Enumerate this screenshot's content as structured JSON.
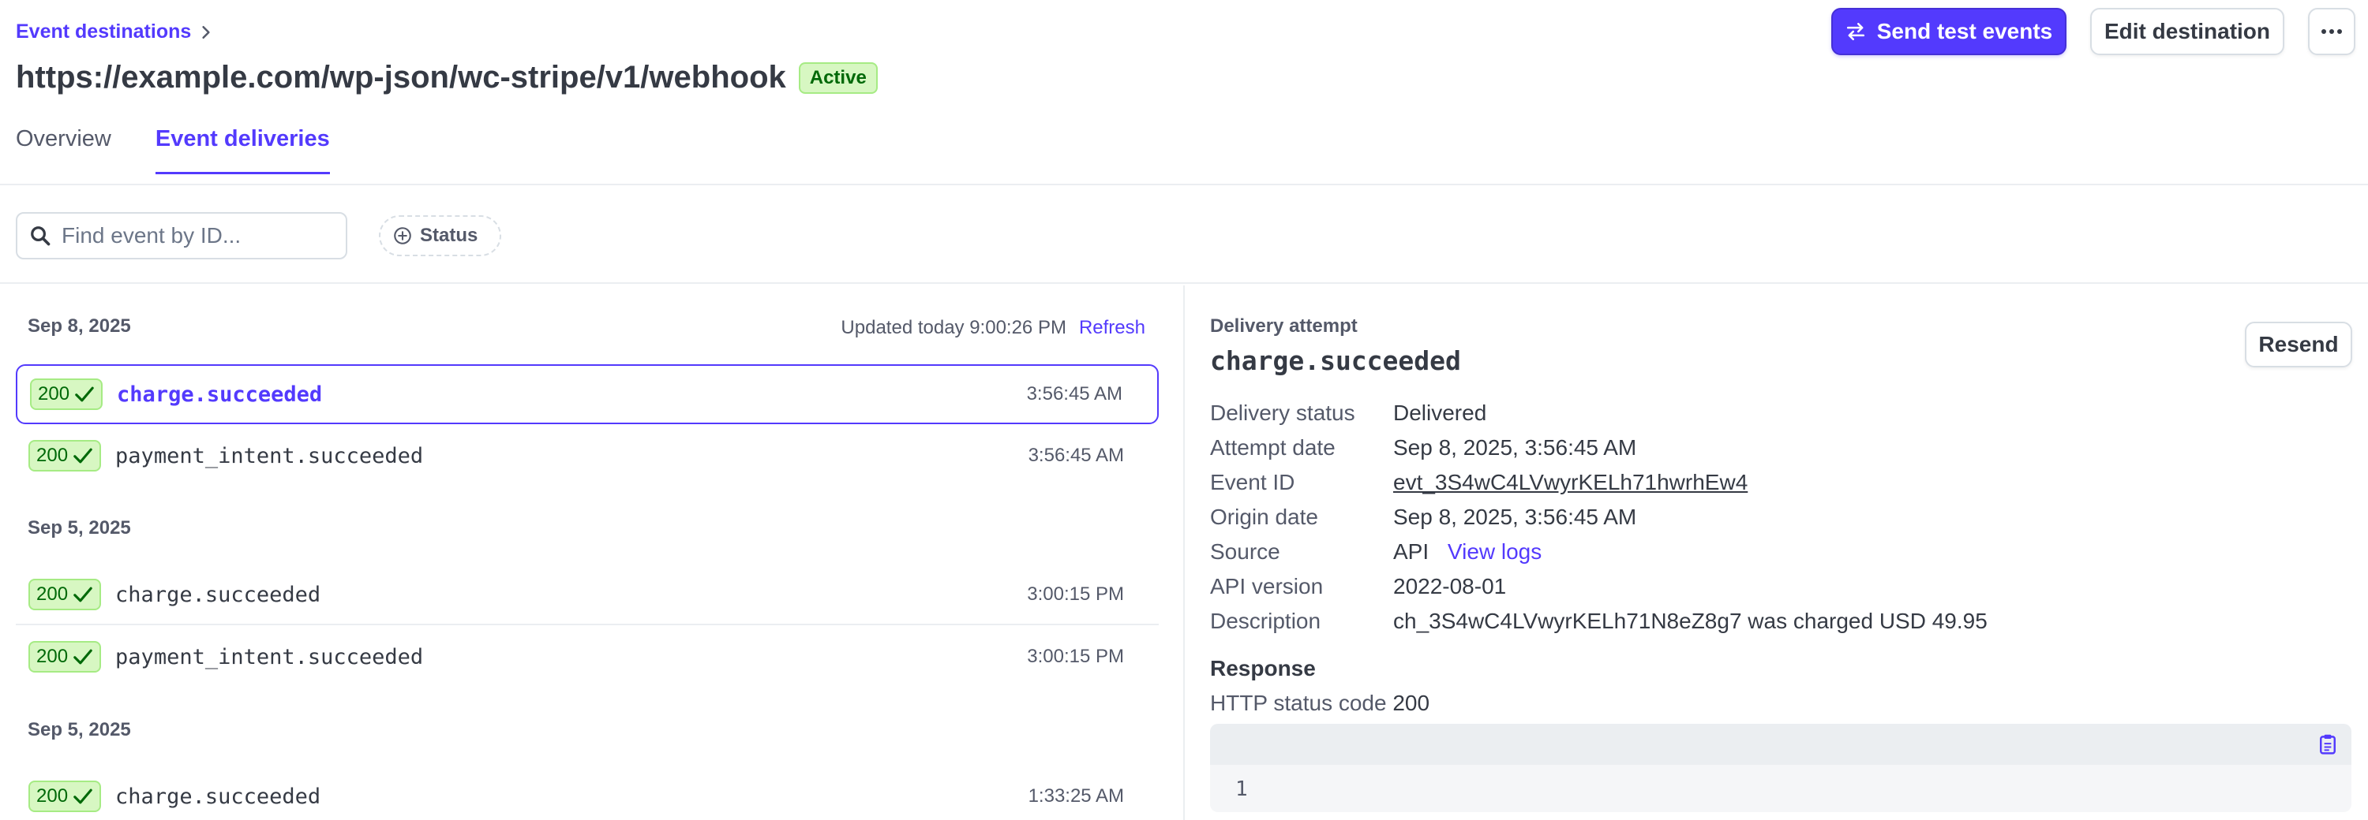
{
  "breadcrumb": {
    "label": "Event destinations"
  },
  "header": {
    "title": "https://example.com/wp-json/wc-stripe/v1/webhook",
    "status_badge": "Active",
    "send_test_label": "Send test events",
    "edit_label": "Edit destination",
    "more_label": "···"
  },
  "tabs": [
    {
      "label": "Overview",
      "active": false
    },
    {
      "label": "Event deliveries",
      "active": true
    }
  ],
  "filters": {
    "search_placeholder": "Find event by ID...",
    "status_label": "Status"
  },
  "deliveries": {
    "updated_text": "Updated today 9:00:26 PM",
    "refresh_label": "Refresh",
    "groups": [
      {
        "date": "Sep 8, 2025",
        "rows": [
          {
            "code": "200",
            "event": "charge.succeeded",
            "time": "3:56:45 AM"
          },
          {
            "code": "200",
            "event": "payment_intent.succeeded",
            "time": "3:56:45 AM"
          }
        ]
      },
      {
        "date": "Sep 5, 2025",
        "rows": [
          {
            "code": "200",
            "event": "charge.succeeded",
            "time": "3:00:15 PM"
          },
          {
            "code": "200",
            "event": "payment_intent.succeeded",
            "time": "3:00:15 PM"
          }
        ]
      },
      {
        "date": "Sep 5, 2025",
        "rows": [
          {
            "code": "200",
            "event": "charge.succeeded",
            "time": "1:33:25 AM"
          }
        ]
      }
    ]
  },
  "detail": {
    "label": "Delivery attempt",
    "title": "charge.succeeded",
    "resend_label": "Resend",
    "fields": [
      {
        "key": "Delivery status",
        "value": "Delivered"
      },
      {
        "key": "Attempt date",
        "value": "Sep 8, 2025, 3:56:45 AM"
      },
      {
        "key": "Event ID",
        "value": "evt_3S4wC4LVwyrKELh71hwrhEw4"
      },
      {
        "key": "Origin date",
        "value": "Sep 8, 2025, 3:56:45 AM"
      },
      {
        "key": "Source",
        "value": "API",
        "link": "View logs"
      },
      {
        "key": "API version",
        "value": "2022-08-01"
      },
      {
        "key": "Description",
        "value": "ch_3S4wC4LVwyrKELh71N8eZ8g7 was charged USD 49.95"
      }
    ],
    "response_title": "Response",
    "http_status_label": "HTTP status code",
    "http_status_value": "200",
    "code_line": "1"
  },
  "colors": {
    "accent": "#533afd",
    "success_bg": "#d7f7c2",
    "success_text": "#006908",
    "text": "#353a44",
    "muted": "#545969"
  }
}
